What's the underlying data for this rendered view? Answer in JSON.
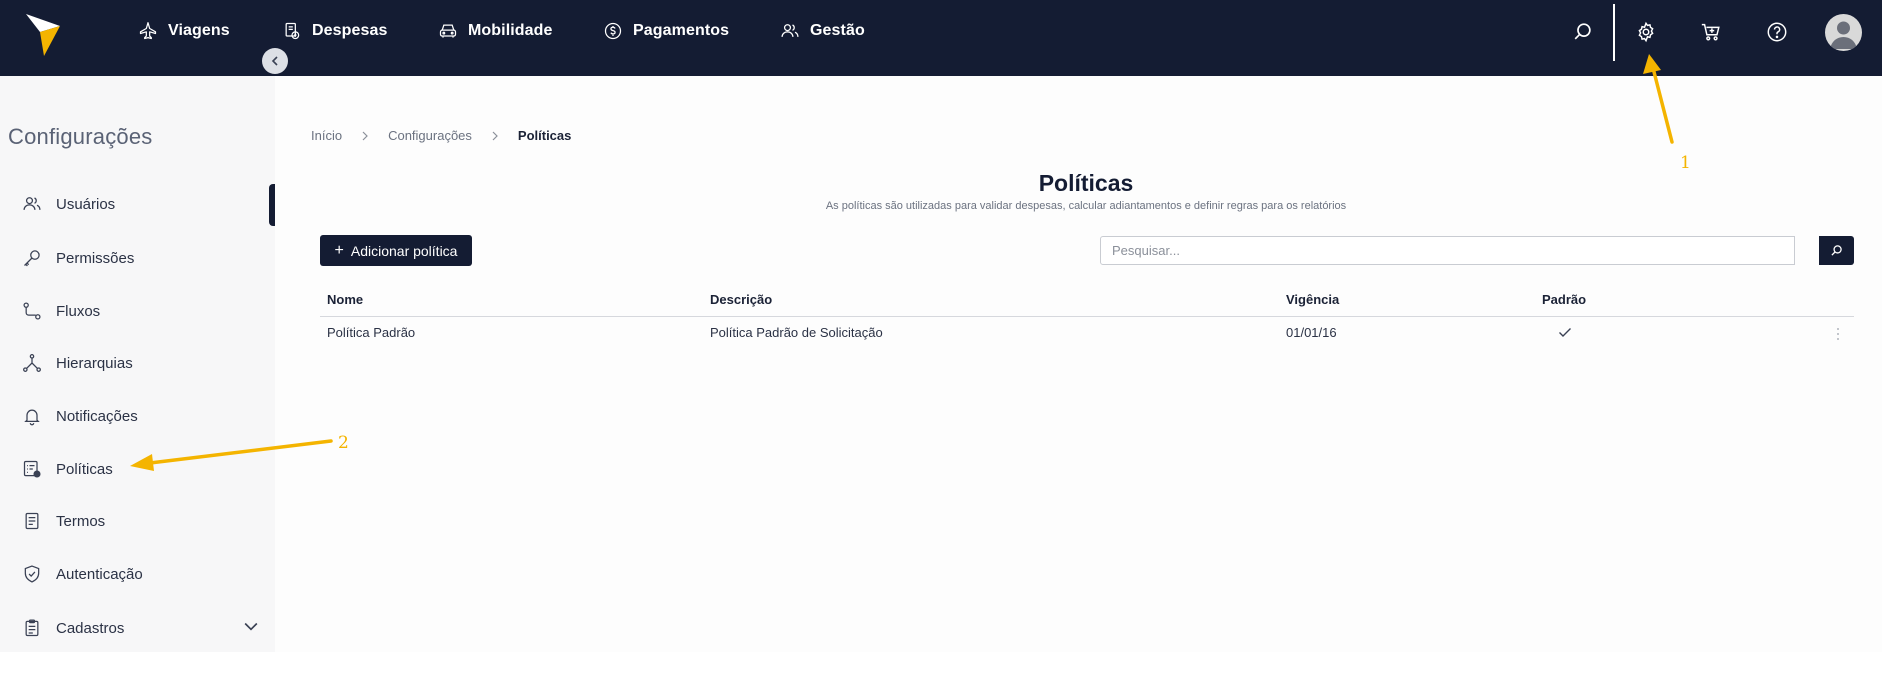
{
  "topbar": {
    "nav": [
      {
        "label": "Viagens",
        "icon": "plane-icon"
      },
      {
        "label": "Despesas",
        "icon": "receipt-icon"
      },
      {
        "label": "Mobilidade",
        "icon": "car-icon"
      },
      {
        "label": "Pagamentos",
        "icon": "dollar-icon"
      },
      {
        "label": "Gestão",
        "icon": "users-icon"
      }
    ]
  },
  "sidebar": {
    "title": "Configurações",
    "items": [
      {
        "label": "Usuários",
        "icon": "users-icon"
      },
      {
        "label": "Permissões",
        "icon": "key-icon"
      },
      {
        "label": "Fluxos",
        "icon": "flow-icon"
      },
      {
        "label": "Hierarquias",
        "icon": "hierarchy-icon"
      },
      {
        "label": "Notificações",
        "icon": "bell-icon"
      },
      {
        "label": "Políticas",
        "icon": "policy-icon"
      },
      {
        "label": "Termos",
        "icon": "document-icon"
      },
      {
        "label": "Autenticação",
        "icon": "shield-icon"
      },
      {
        "label": "Cadastros",
        "icon": "clipboard-icon"
      }
    ]
  },
  "breadcrumb": {
    "items": [
      "Início",
      "Configurações",
      "Políticas"
    ]
  },
  "page": {
    "title": "Políticas",
    "subtitle": "As políticas são utilizadas para validar despesas, calcular adiantamentos e definir regras para os relatórios",
    "add_button": "Adicionar política",
    "search_placeholder": "Pesquisar..."
  },
  "table": {
    "headers": [
      "Nome",
      "Descrição",
      "Vigência",
      "Padrão"
    ],
    "rows": [
      {
        "nome": "Política Padrão",
        "descricao": "Política Padrão de Solicitação",
        "vigencia": "01/01/16",
        "padrao": true
      }
    ]
  },
  "annotations": [
    "1",
    "2"
  ],
  "colors": {
    "topbar": "#141c33",
    "annotation": "#f4b400"
  }
}
